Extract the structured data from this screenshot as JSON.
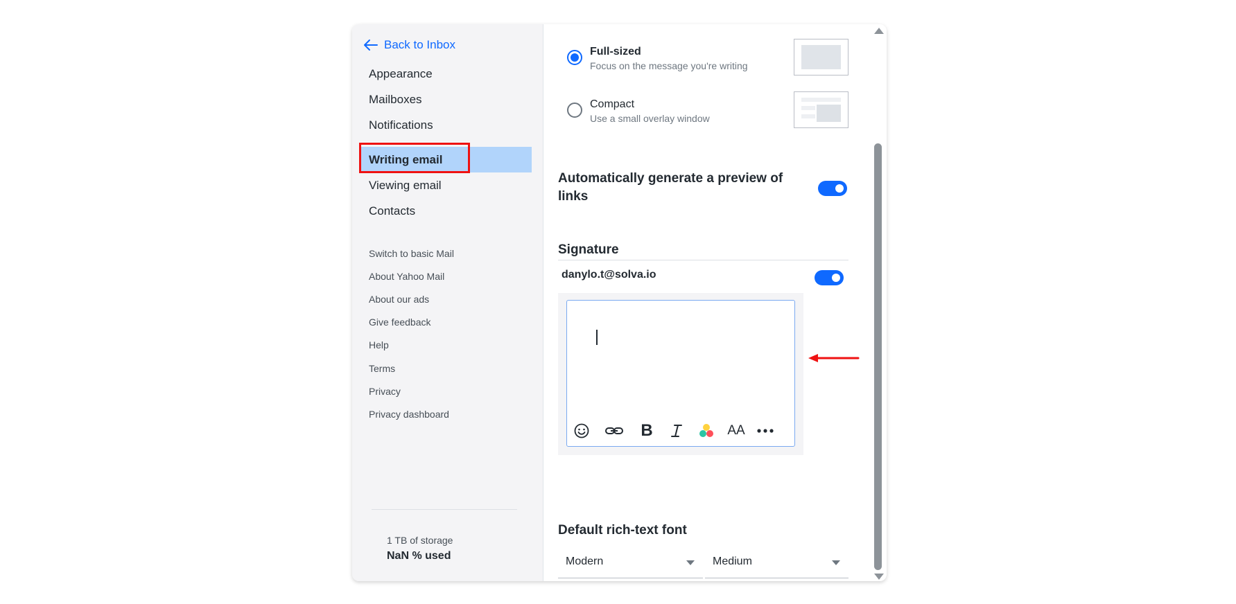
{
  "sidebar": {
    "back_label": "Back to Inbox",
    "nav": [
      "Appearance",
      "Mailboxes",
      "Notifications",
      "Writing email",
      "Viewing email",
      "Contacts"
    ],
    "active": "Writing email",
    "links": [
      "Switch to basic Mail",
      "About Yahoo Mail",
      "About our ads",
      "Give feedback",
      "Help",
      "Terms",
      "Privacy",
      "Privacy dashboard"
    ],
    "storage_label": "1 TB of storage",
    "storage_used": "NaN % used"
  },
  "compose_style": {
    "options": [
      {
        "title": "Full-sized",
        "desc": "Focus on the message you're writing",
        "selected": true
      },
      {
        "title": "Compact",
        "desc": "Use a small overlay window",
        "selected": false
      }
    ]
  },
  "link_preview": {
    "title_line1": "Automatically generate a preview of",
    "title_line2": "links",
    "enabled": true
  },
  "signature": {
    "title": "Signature",
    "email": "danylo.t@solva.io",
    "enabled": true,
    "toolbar_icons": [
      "emoji-icon",
      "link-icon",
      "bold-icon",
      "italic-icon",
      "color-icon",
      "font-size-icon",
      "more-icon"
    ]
  },
  "default_font": {
    "title": "Default rich-text font",
    "family": "Modern",
    "size": "Medium"
  },
  "colors": {
    "accent": "#0f69ff",
    "active_bg": "#b1d4fb",
    "highlight": "#ef1212"
  }
}
